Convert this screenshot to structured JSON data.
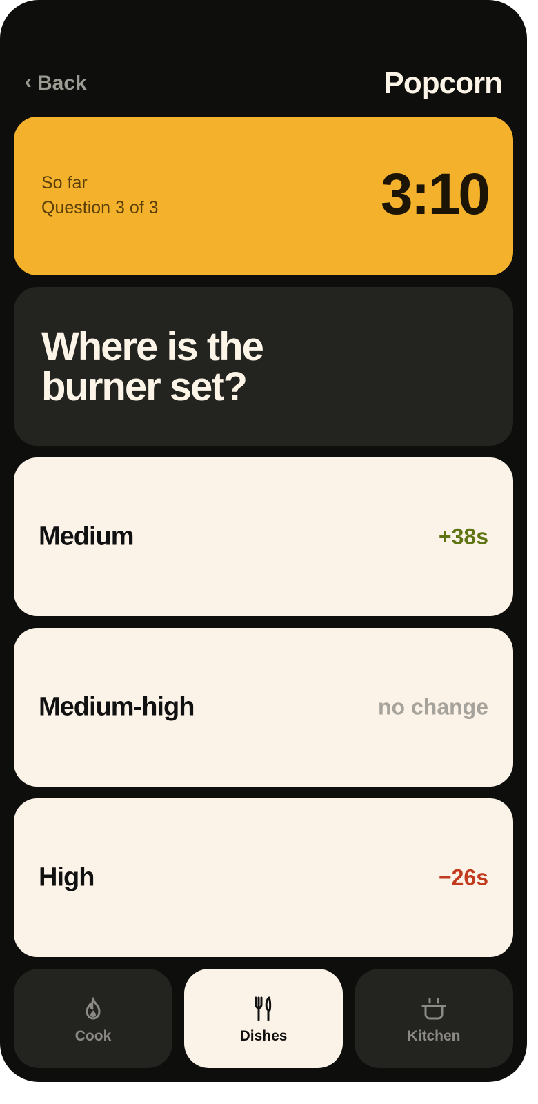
{
  "header": {
    "back_label": "Back",
    "title": "Popcorn"
  },
  "timer": {
    "caption": "So far",
    "progress": "Question 3 of 3",
    "time": "3:10"
  },
  "question": {
    "text": "Where is the burner set?"
  },
  "options": [
    {
      "label": "Medium",
      "delta": "+38s",
      "tone": "positive"
    },
    {
      "label": "Medium-high",
      "delta": "no change",
      "tone": "neutral"
    },
    {
      "label": "High",
      "delta": "−26s",
      "tone": "negative"
    }
  ],
  "nav": {
    "items": [
      {
        "label": "Cook",
        "icon": "flame-icon",
        "active": false
      },
      {
        "label": "Dishes",
        "icon": "fork-knife-icon",
        "active": true
      },
      {
        "label": "Kitchen",
        "icon": "pot-icon",
        "active": false
      }
    ]
  },
  "colors": {
    "background": "#0e0e0d",
    "accent": "#f4b12b",
    "card_dark": "#232320",
    "card_light": "#fcf3e8",
    "positive": "#5f7514",
    "negative": "#c23a1d",
    "neutral": "#a6a39c"
  }
}
